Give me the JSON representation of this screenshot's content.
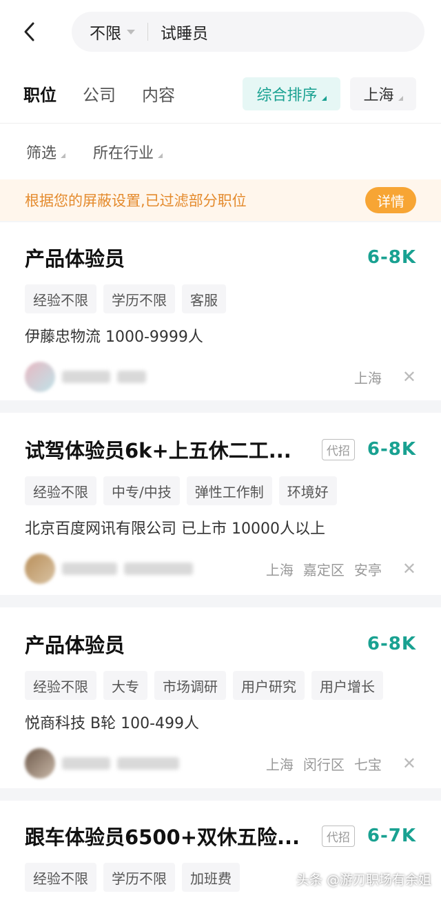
{
  "search": {
    "filter_value": "不限",
    "query": "试睡员"
  },
  "tabs": [
    {
      "label": "职位",
      "active": true
    },
    {
      "label": "公司",
      "active": false
    },
    {
      "label": "内容",
      "active": false
    }
  ],
  "sort": {
    "label": "综合排序"
  },
  "city": {
    "label": "上海"
  },
  "filters": [
    {
      "label": "筛选"
    },
    {
      "label": "所在行业"
    }
  ],
  "notice": {
    "text": "根据您的屏蔽设置,已过滤部分职位",
    "button": "详情"
  },
  "jobs": [
    {
      "title": "产品体验员",
      "badge": "",
      "salary": "6-8K",
      "tags": [
        "经验不限",
        "学历不限",
        "客服"
      ],
      "company": "伊藤忠物流  1000-9999人",
      "location": [
        "上海"
      ]
    },
    {
      "title": "试驾体验员6k+上五休二工...",
      "badge": "代招",
      "salary": "6-8K",
      "tags": [
        "经验不限",
        "中专/中技",
        "弹性工作制",
        "环境好"
      ],
      "company": "北京百度网讯有限公司  已上市  10000人以上",
      "location": [
        "上海",
        "嘉定区",
        "安亭"
      ]
    },
    {
      "title": "产品体验员",
      "badge": "",
      "salary": "6-8K",
      "tags": [
        "经验不限",
        "大专",
        "市场调研",
        "用户研究",
        "用户增长"
      ],
      "company": "悦商科技  B轮  100-499人",
      "location": [
        "上海",
        "闵行区",
        "七宝"
      ]
    },
    {
      "title": "跟车体验员6500+双休五险...",
      "badge": "代招",
      "salary": "6-7K",
      "tags": [
        "经验不限",
        "学历不限",
        "加班费"
      ],
      "company": "",
      "location": []
    }
  ],
  "watermark": "头条 @游刃职场有余姐",
  "colors": {
    "accent": "#19a191",
    "notice_text": "#e48a2c",
    "notice_button": "#f7a534"
  }
}
